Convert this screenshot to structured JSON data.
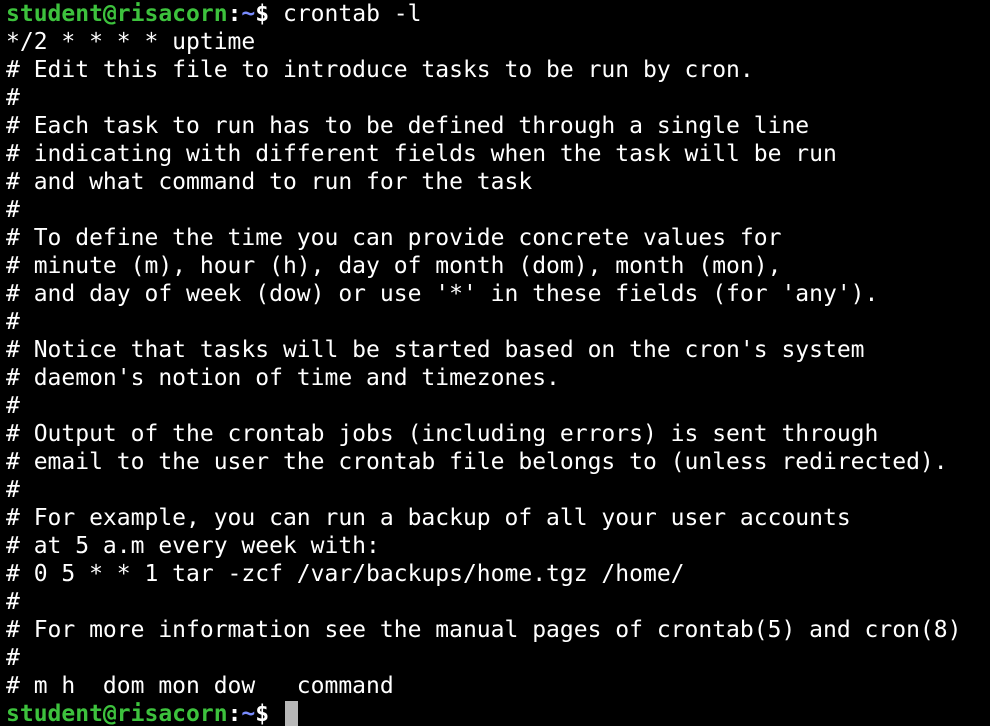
{
  "colors": {
    "background": "#000000",
    "text": "#ffffff",
    "prompt_user": "#3dc23d",
    "prompt_path": "#7a8cff",
    "cursor": "#b7b7b7"
  },
  "prompt": {
    "user_host": "student@risacorn",
    "colon": ":",
    "path": "~",
    "symbol": "$",
    "command": " crontab -l"
  },
  "output_lines": [
    "*/2 * * * * uptime",
    "# Edit this file to introduce tasks to be run by cron.",
    "#",
    "# Each task to run has to be defined through a single line",
    "# indicating with different fields when the task will be run",
    "# and what command to run for the task",
    "#",
    "# To define the time you can provide concrete values for",
    "# minute (m), hour (h), day of month (dom), month (mon),",
    "# and day of week (dow) or use '*' in these fields (for 'any').",
    "#",
    "# Notice that tasks will be started based on the cron's system",
    "# daemon's notion of time and timezones.",
    "#",
    "# Output of the crontab jobs (including errors) is sent through",
    "# email to the user the crontab file belongs to (unless redirected).",
    "#",
    "# For example, you can run a backup of all your user accounts",
    "# at 5 a.m every week with:",
    "# 0 5 * * 1 tar -zcf /var/backups/home.tgz /home/",
    "#",
    "# For more information see the manual pages of crontab(5) and cron(8)",
    "#",
    "# m h  dom mon dow   command"
  ],
  "final_prompt": {
    "user_host": "student@risacorn",
    "colon": ":",
    "path": "~",
    "symbol": "$ "
  }
}
